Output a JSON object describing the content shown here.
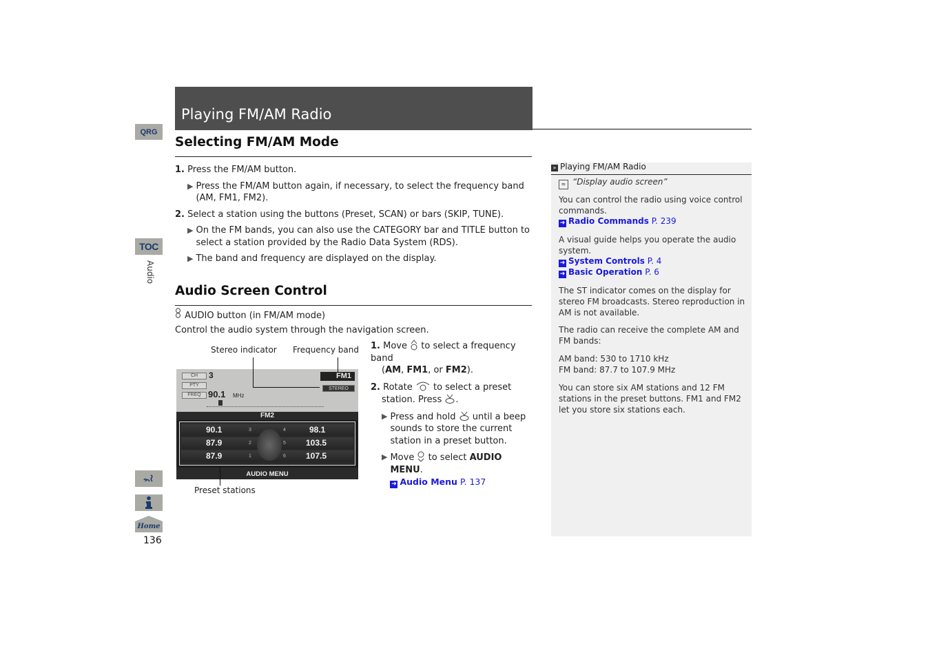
{
  "nav": {
    "qrg": "QRG",
    "toc": "TOC",
    "section_label": "Audio",
    "voice_icon": "voice-command-icon",
    "info_icon": "info-icon",
    "home": "Home",
    "page_number": "136"
  },
  "header": {
    "title": "Playing FM/AM Radio"
  },
  "section1": {
    "heading": "Selecting FM/AM Mode",
    "steps": [
      {
        "num": "1.",
        "text": "Press the FM/AM button.",
        "subs": [
          "Press the FM/AM button again, if necessary, to select the frequency band (AM, FM1, FM2)."
        ]
      },
      {
        "num": "2.",
        "text": "Select a station using the buttons (Preset, SCAN) or bars (SKIP, TUNE).",
        "subs": [
          "On the FM bands, you can also use the CATEGORY bar and TITLE button to select a station provided by the Radio Data System (RDS).",
          "The band and frequency are displayed on the display."
        ]
      }
    ]
  },
  "section2": {
    "heading": "Audio Screen Control",
    "button_ref": "AUDIO button (in FM/AM mode)",
    "intro": "Control the audio system through the navigation screen.",
    "callouts": {
      "stereo": "Stereo indicator",
      "band": "Frequency band",
      "presets": "Preset stations"
    },
    "screen": {
      "ch_label": "CH",
      "ch_value": "3",
      "pty_label": "PTY",
      "freq_label": "FREQ",
      "freq_value": "90.1",
      "freq_unit": "MHz",
      "band": "FM1",
      "stereo": "STEREO",
      "preset_band": "FM2",
      "presets": [
        {
          "num": "3",
          "freq": "90.1"
        },
        {
          "num": "2",
          "freq": "87.9"
        },
        {
          "num": "1",
          "freq": "87.9"
        },
        {
          "num": "4",
          "freq": "98.1"
        },
        {
          "num": "5",
          "freq": "103.5"
        },
        {
          "num": "6",
          "freq": "107.5"
        }
      ],
      "menu": "AUDIO MENU"
    },
    "steps": {
      "s1_num": "1.",
      "s1_a": "Move",
      "s1_b": "to select a frequency band",
      "s1_c_open": "(",
      "s1_am": "AM",
      "s1_sep1": ", ",
      "s1_fm1": "FM1",
      "s1_sep2": ", or ",
      "s1_fm2": "FM2",
      "s1_close": ").",
      "s2_num": "2.",
      "s2_a": "Rotate",
      "s2_b": "to select a preset",
      "s2_c": "station. Press",
      "s2_d": ".",
      "sub1_a": "Press and hold",
      "sub1_b": "until a beep sounds to store the current station in a preset button.",
      "sub2_a": "Move",
      "sub2_b": "to select",
      "sub2_bold": "AUDIO MENU",
      "sub2_end": ".",
      "link_label": "Audio Menu",
      "link_page": "P. 137"
    }
  },
  "sidebar": {
    "heading": "Playing FM/AM Radio",
    "voice_cmd": "“Display audio screen”",
    "p1": "You can control the radio using voice control commands.",
    "link1": {
      "label": "Radio Commands",
      "page": "P. 239"
    },
    "p2": "A visual guide helps you operate the audio system.",
    "link2": {
      "label": "System Controls",
      "page": "P. 4"
    },
    "link3": {
      "label": "Basic Operation",
      "page": "P. 6"
    },
    "p3": "The ST indicator comes on the display for stereo FM broadcasts. Stereo reproduction in AM is not available.",
    "p4": "The radio can receive the complete AM and FM bands:",
    "am_band": "AM band: 530 to 1710 kHz",
    "fm_band": "FM band: 87.7 to 107.9 MHz",
    "p5": "You can store six AM stations and 12 FM stations in the preset buttons. FM1 and FM2 let you store six stations each."
  }
}
